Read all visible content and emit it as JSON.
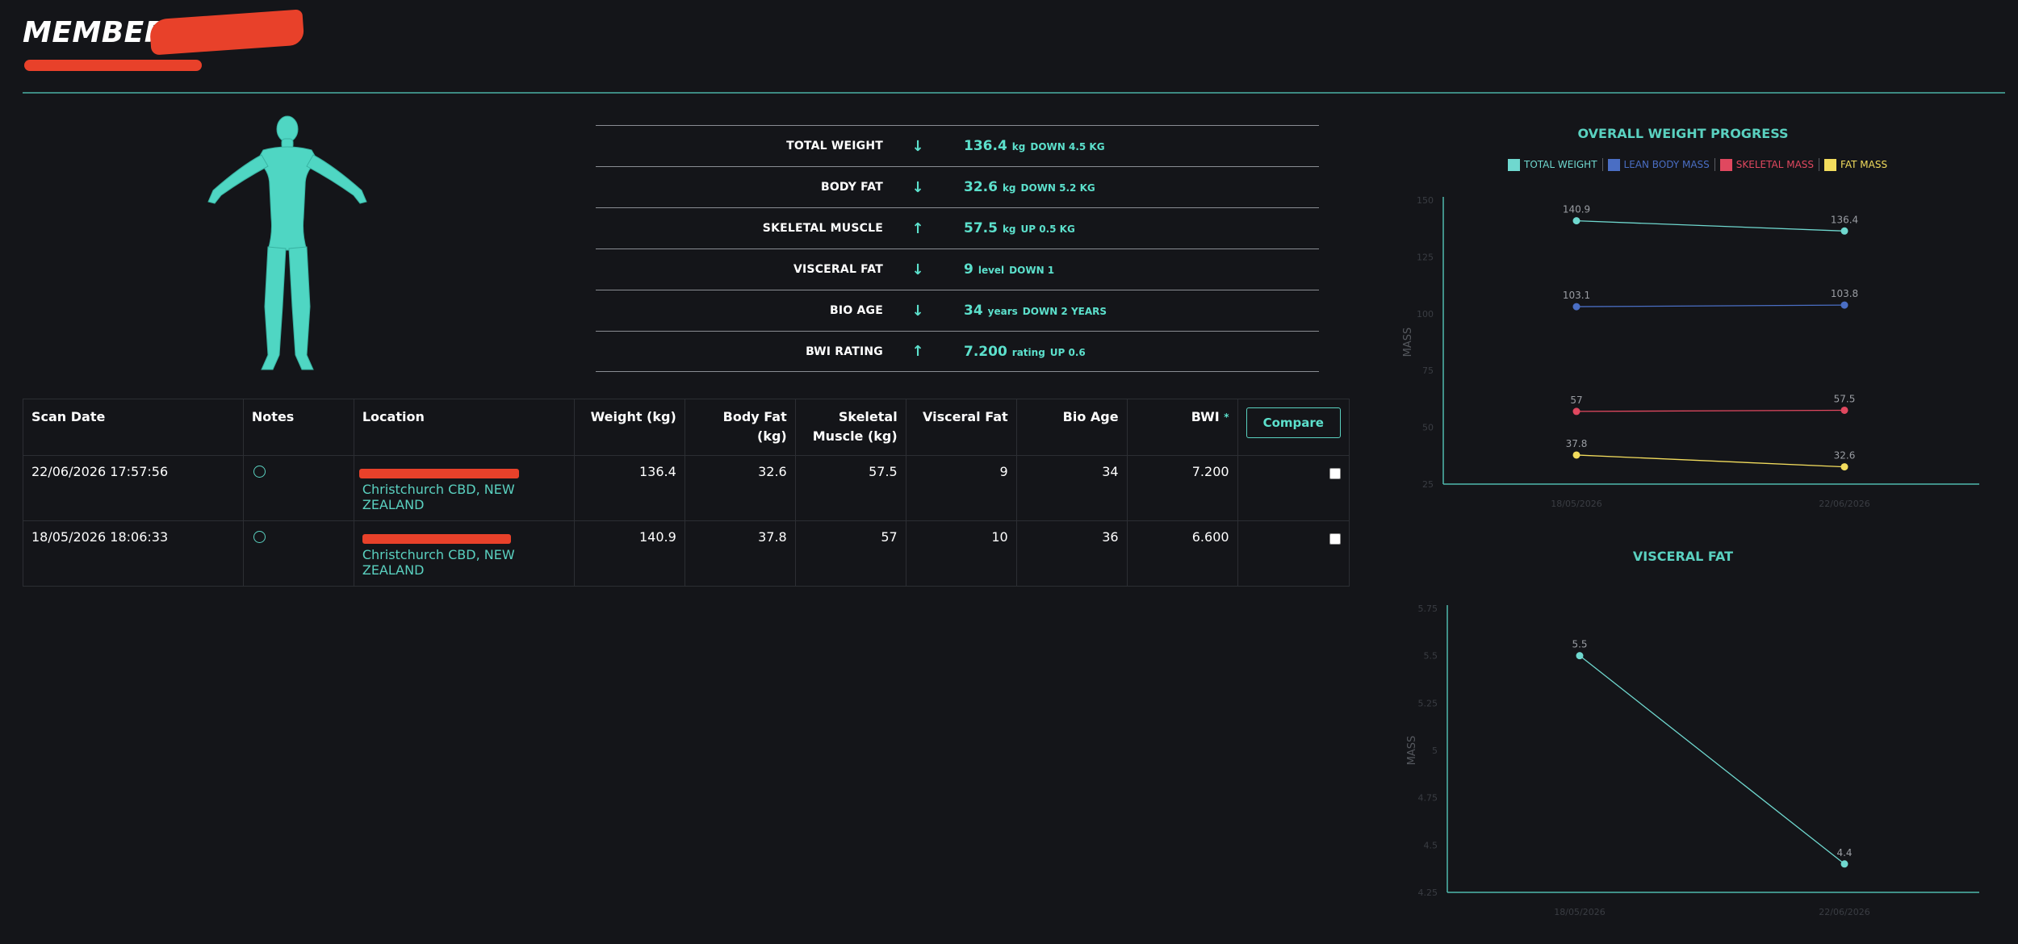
{
  "header": {
    "title": "MEMBER :"
  },
  "metrics": [
    {
      "label": "TOTAL WEIGHT",
      "arrow": "↓",
      "value": "136.4",
      "unit": "kg",
      "change": "DOWN 4.5 KG"
    },
    {
      "label": "BODY FAT",
      "arrow": "↓",
      "value": "32.6",
      "unit": "kg",
      "change": "DOWN 5.2 KG"
    },
    {
      "label": "SKELETAL MUSCLE",
      "arrow": "↑",
      "value": "57.5",
      "unit": "kg",
      "change": "UP 0.5 KG"
    },
    {
      "label": "VISCERAL FAT",
      "arrow": "↓",
      "value": "9",
      "unit": "level",
      "change": "DOWN 1"
    },
    {
      "label": "BIO AGE",
      "arrow": "↓",
      "value": "34",
      "unit": "years",
      "change": "DOWN 2 YEARS"
    },
    {
      "label": "BWI RATING",
      "arrow": "↑",
      "value": "7.200",
      "unit": "rating",
      "change": "UP 0.6"
    }
  ],
  "table": {
    "headers": {
      "scan_date": "Scan Date",
      "notes": "Notes",
      "location": "Location",
      "weight": "Weight (kg)",
      "body_fat": "Body Fat (kg)",
      "skeletal": "Skeletal Muscle (kg)",
      "visceral": "Visceral Fat",
      "bio_age": "Bio Age",
      "bwi": "BWI",
      "bwi_marker": "*",
      "compare": "Compare"
    },
    "rows": [
      {
        "date": "22/06/2026 17:57:56",
        "location": "Christchurch CBD, NEW ZEALAND",
        "weight": "136.4",
        "body_fat": "32.6",
        "skeletal": "57.5",
        "visceral": "9",
        "bio_age": "34",
        "bwi": "7.200"
      },
      {
        "date": "18/05/2026 18:06:33",
        "location": "Christchurch CBD, NEW ZEALAND",
        "weight": "140.9",
        "body_fat": "37.8",
        "skeletal": "57",
        "visceral": "10",
        "bio_age": "36",
        "bwi": "6.600"
      }
    ]
  },
  "colors": {
    "accent": "#5ad1c0",
    "background": "#141519",
    "redaction": "#e8412a"
  },
  "chart_data": [
    {
      "type": "line",
      "title": "OVERALL WEIGHT PROGRESS",
      "ylabel": "MASS",
      "xlabel": "",
      "x": [
        "18/05/2026",
        "22/06/2026"
      ],
      "ylim": [
        25,
        150
      ],
      "yticks": [
        25,
        50,
        75,
        100,
        125,
        150
      ],
      "legend_position": "top",
      "series": [
        {
          "name": "TOTAL WEIGHT",
          "color": "#6fd8cf",
          "values": [
            140.9,
            136.4
          ],
          "labels": [
            "140.9",
            "136.4"
          ]
        },
        {
          "name": "LEAN BODY MASS",
          "color": "#4a6ec4",
          "values": [
            103.1,
            103.8
          ],
          "labels": [
            "103.1",
            "103.8"
          ]
        },
        {
          "name": "SKELETAL MASS",
          "color": "#e0485f",
          "values": [
            57,
            57.5
          ],
          "labels": [
            "57",
            "57.5"
          ]
        },
        {
          "name": "FAT MASS",
          "color": "#f2dc5d",
          "values": [
            37.8,
            32.6
          ],
          "labels": [
            "37.8",
            "32.6"
          ]
        }
      ]
    },
    {
      "type": "line",
      "title": "VISCERAL FAT",
      "ylabel": "MASS",
      "xlabel": "",
      "x": [
        "18/05/2026",
        "22/06/2026"
      ],
      "ylim": [
        4.25,
        5.75
      ],
      "yticks": [
        "4.25",
        "4.5",
        "4.75",
        "5",
        "5.25",
        "5.5",
        "5.75"
      ],
      "series": [
        {
          "color": "#6fd8cf",
          "values": [
            5.5,
            4.4
          ],
          "labels": [
            "5.5",
            "4.4"
          ]
        }
      ]
    }
  ]
}
